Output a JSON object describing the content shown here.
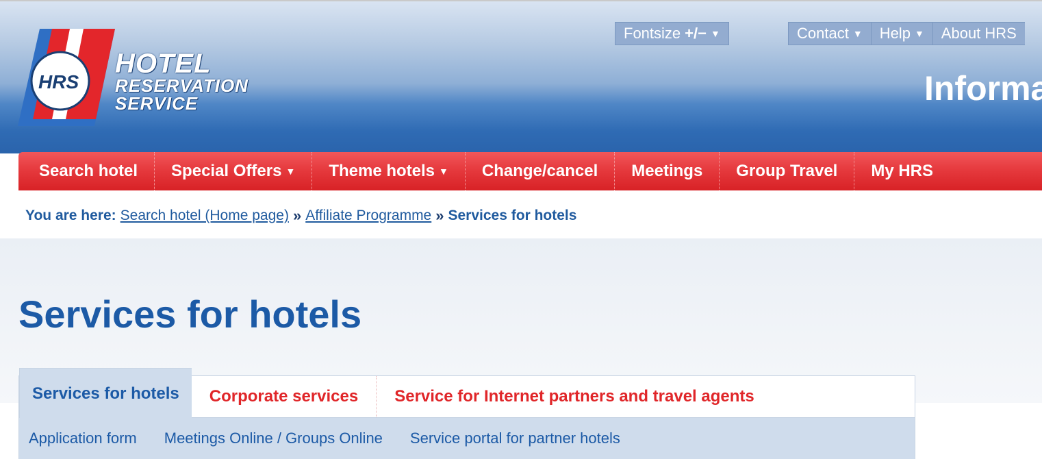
{
  "header": {
    "logo": {
      "emblem_text": "HRS",
      "line1": "HOTEL",
      "line2": "RESERVATION",
      "line3": "SERVICE"
    },
    "fontsize": {
      "label": "Fontsize",
      "controls": "+/−"
    },
    "menus": [
      {
        "label": "Contact"
      },
      {
        "label": "Help"
      },
      {
        "label": "About HRS"
      }
    ],
    "info_title": "Information"
  },
  "nav": {
    "items": [
      {
        "label": "Search hotel",
        "dropdown": false
      },
      {
        "label": "Special Offers",
        "dropdown": true
      },
      {
        "label": "Theme hotels",
        "dropdown": true
      },
      {
        "label": "Change/cancel",
        "dropdown": false
      },
      {
        "label": "Meetings",
        "dropdown": false
      },
      {
        "label": "Group Travel",
        "dropdown": false
      },
      {
        "label": "My HRS",
        "dropdown": false
      }
    ]
  },
  "breadcrumb": {
    "prefix": "You are here:",
    "links": [
      "Search hotel (Home page)",
      "Affiliate Programme"
    ],
    "separator": "»",
    "current": "Services for hotels"
  },
  "page_title": "Services for hotels",
  "tabs": [
    {
      "label": "Services for hotels",
      "active": true
    },
    {
      "label": "Corporate services",
      "active": false
    },
    {
      "label": "Service for Internet partners and travel agents",
      "active": false
    }
  ],
  "subtabs": [
    {
      "label": "Application form"
    },
    {
      "label": "Meetings Online / Groups Online"
    },
    {
      "label": "Service portal for partner hotels"
    }
  ],
  "colors": {
    "brand_blue": "#1c5aa6",
    "nav_red": "#e63a3e",
    "tab_red": "#e02629",
    "subtab_bg": "#cfdcec"
  }
}
